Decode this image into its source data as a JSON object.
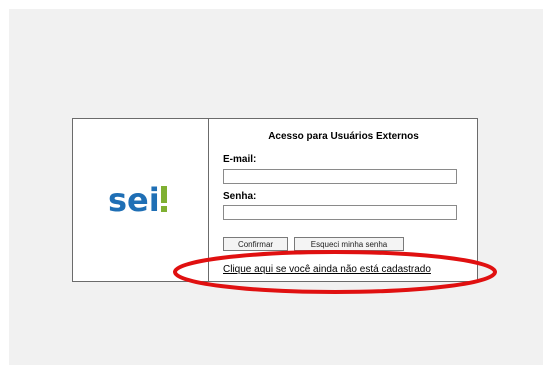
{
  "brand": {
    "logo_text": "sei!"
  },
  "login": {
    "title": "Acesso para Usuários Externos",
    "email_label": "E-mail:",
    "email_value": "",
    "senha_label": "Senha:",
    "senha_value": "",
    "confirm_button": "Confirmar",
    "forgot_button": "Esqueci minha senha",
    "register_link": "Clique aqui se você ainda não está cadastrado"
  },
  "colors": {
    "logo_blue": "#1f6fb5",
    "logo_green": "#7fb032",
    "highlight_red": "#e01010"
  }
}
